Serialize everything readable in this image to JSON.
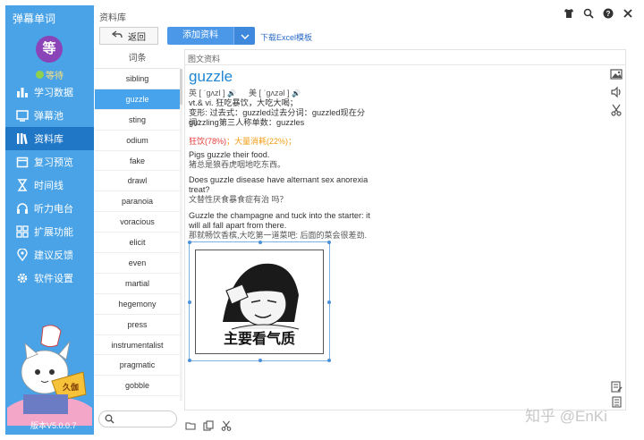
{
  "app": {
    "title": "弹幕单词",
    "version": "版本V5.0.0.7"
  },
  "user": {
    "avatar_text": "等",
    "level": "等待"
  },
  "sidebar": {
    "items": [
      {
        "label": "学习数据",
        "icon": "bar-chart-icon"
      },
      {
        "label": "弹幕池",
        "icon": "screen-icon"
      },
      {
        "label": "资料库",
        "icon": "books-icon",
        "active": true
      },
      {
        "label": "复习预览",
        "icon": "calendar-icon"
      },
      {
        "label": "时间线",
        "icon": "hourglass-icon"
      },
      {
        "label": "听力电台",
        "icon": "headphones-icon"
      },
      {
        "label": "扩展功能",
        "icon": "grid-icon"
      },
      {
        "label": "建议反馈",
        "icon": "location-icon"
      },
      {
        "label": "软件设置",
        "icon": "gear-icon"
      }
    ]
  },
  "topbar": {
    "breadcrumb": "资料库"
  },
  "toolbar": {
    "back_label": "返回",
    "add_label": "添加资料",
    "excel_link": "下载Excel模板"
  },
  "wordlist": {
    "header": "词条",
    "items": [
      "sibling",
      "guzzle",
      "sting",
      "odium",
      "fake",
      "drawl",
      "paranoia",
      "voracious",
      "elicit",
      "even",
      "martial",
      "hegemony",
      "press",
      "instrumentalist",
      "pragmatic",
      "gobble"
    ],
    "active_index": 1
  },
  "content": {
    "tab": "图文资料",
    "headword": "guzzle",
    "phonetic_uk": "英 [ ˈɡʌzl ]",
    "phonetic_us": "美 [ ˈɡʌzəl ]",
    "definition": "vt.& vi. 狂吃暴饮，大吃大喝；",
    "forms_line1": "变形: 过去式：guzzled过去分词：guzzled现在分词：",
    "forms_line2": "guzzling第三人称单数：guzzles",
    "freq_red": "狂饮(78%)",
    "freq_orange": "；大量消耗(22%)；",
    "examples": [
      {
        "en": "Pigs guzzle their food.",
        "cn": "猪总是狼吞虎咽地吃东西。"
      },
      {
        "en": "Does guzzle disease have alternant sex anorexia treat?",
        "cn": "文替性厌食暴食症有治 吗？"
      },
      {
        "en": "Guzzle the champagne and tuck into the starter: it will all fall apart from there.",
        "cn": "那就畅饮香槟,大吃第一道菜吧: 后面的菜会很差劲."
      }
    ],
    "meme_caption": "主要看气质"
  },
  "watermark": "知乎 @EnKi",
  "colors": {
    "sidebar": "#4aa3e6",
    "active": "#47a3ec",
    "headword": "#1f86d4",
    "red": "#e53935",
    "orange": "#f39c12"
  }
}
